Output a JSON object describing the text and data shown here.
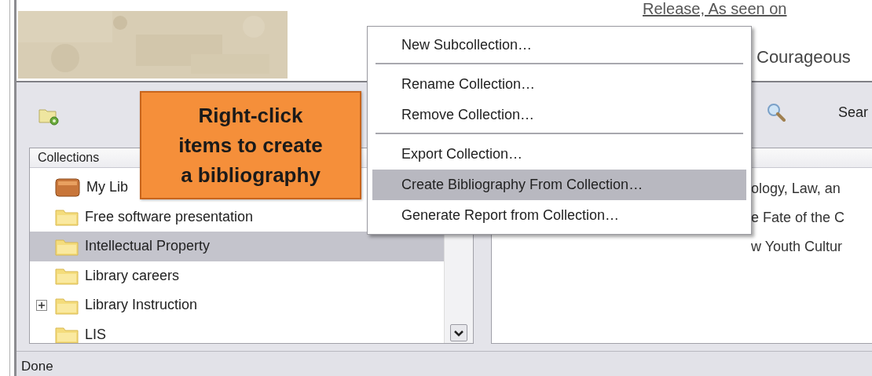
{
  "page_top": {
    "picture": {
      "kind": "picture"
    },
    "headlines": [
      "Release, As seen on",
      "Courageous"
    ]
  },
  "toolbar": {
    "search_label": "Sear"
  },
  "collections": {
    "header": "Collections",
    "items": [
      {
        "label": "My Lib",
        "kind": "library",
        "expander": false,
        "selected": false
      },
      {
        "label": "Free software presentation",
        "kind": "folder",
        "expander": false,
        "selected": false
      },
      {
        "label": "Intellectual Property",
        "kind": "folder",
        "expander": false,
        "selected": true
      },
      {
        "label": "Library careers",
        "kind": "folder",
        "expander": false,
        "selected": false
      },
      {
        "label": "Library Instruction",
        "kind": "folder",
        "expander": true,
        "selected": false
      },
      {
        "label": "LIS",
        "kind": "folder",
        "expander": false,
        "selected": false
      }
    ]
  },
  "items_pane": {
    "rows": [
      "ology, Law, an",
      "e Fate of the C",
      "w Youth Cultur"
    ]
  },
  "context_menu": {
    "groups": [
      [
        {
          "label": "New Subcollection…",
          "selected": false
        }
      ],
      [
        {
          "label": "Rename Collection…",
          "selected": false
        },
        {
          "label": "Remove Collection…",
          "selected": false
        }
      ],
      [
        {
          "label": "Export Collection…",
          "selected": false
        },
        {
          "label": "Create Bibliography From Collection…",
          "selected": true
        },
        {
          "label": "Generate Report from Collection…",
          "selected": false
        }
      ]
    ]
  },
  "callout": {
    "text": "Right-click items to create a bibliography"
  },
  "status_bar": {
    "text": "Done"
  }
}
